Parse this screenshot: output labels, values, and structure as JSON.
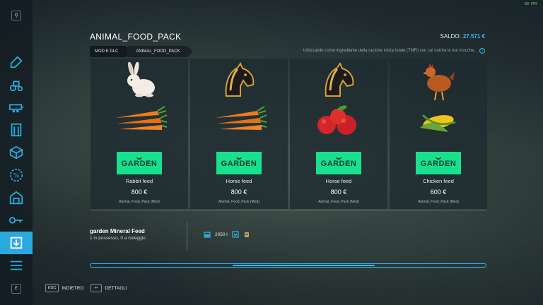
{
  "fps_text": "60 FPS",
  "header": {
    "title": "ANIMAL_FOOD_PACK",
    "balance_label": "SALDO:",
    "balance_value": "27.571 €"
  },
  "breadcrumb": [
    "MOD E DLC",
    "ANIMAL_FOOD_PACK"
  ],
  "description": "Utilizzabile come ingrediente della razione mista totale (TMR) con cui nutrire le tue mucche.",
  "sidebar": {
    "top_key": "Q",
    "bottom_key": "E",
    "items": [
      {
        "icon": "wrench-icon"
      },
      {
        "icon": "tractor-icon"
      },
      {
        "icon": "trailer-icon"
      },
      {
        "icon": "silo-icon"
      },
      {
        "icon": "box-icon"
      },
      {
        "icon": "discount-icon"
      },
      {
        "icon": "barn-icon"
      },
      {
        "icon": "key-icon"
      },
      {
        "icon": "download-icon",
        "active": true
      },
      {
        "icon": "menu-icon"
      }
    ]
  },
  "cards": [
    {
      "animal": "rabbit",
      "food": "carrots",
      "brand": "GARDEN",
      "name": "Rabbit feed",
      "price": "800 €",
      "source": "Animal_Food_Pack (Mod)"
    },
    {
      "animal": "horse",
      "food": "carrots",
      "brand": "GARDEN",
      "name": "Horse feed",
      "price": "800 €",
      "source": "Animal_Food_Pack (Mod)"
    },
    {
      "animal": "horse",
      "food": "apples",
      "brand": "GARDEN",
      "name": "Horse feed",
      "price": "800 €",
      "source": "Animal_Food_Pack (Mod)"
    },
    {
      "animal": "chicken",
      "food": "corn",
      "brand": "GARDEN",
      "name": "Chicken feed",
      "price": "600 €",
      "source": "Animal_Food_Pack (Mod)"
    }
  ],
  "detail": {
    "name": "garden Mineral Feed",
    "status": "1 in possesso, 0 a noleggio",
    "capacity": "2050 l"
  },
  "scroll": {
    "thumb_start": 0.36,
    "thumb_end": 0.72
  },
  "footer": {
    "back_key": "ESC",
    "back_label": "INDIETRO",
    "details_key": "↵",
    "details_label": "DETTAGLI"
  },
  "colors": {
    "accent": "#33b8ee",
    "brand_green": "#19e08d",
    "active_tab": "#2aa9de"
  }
}
